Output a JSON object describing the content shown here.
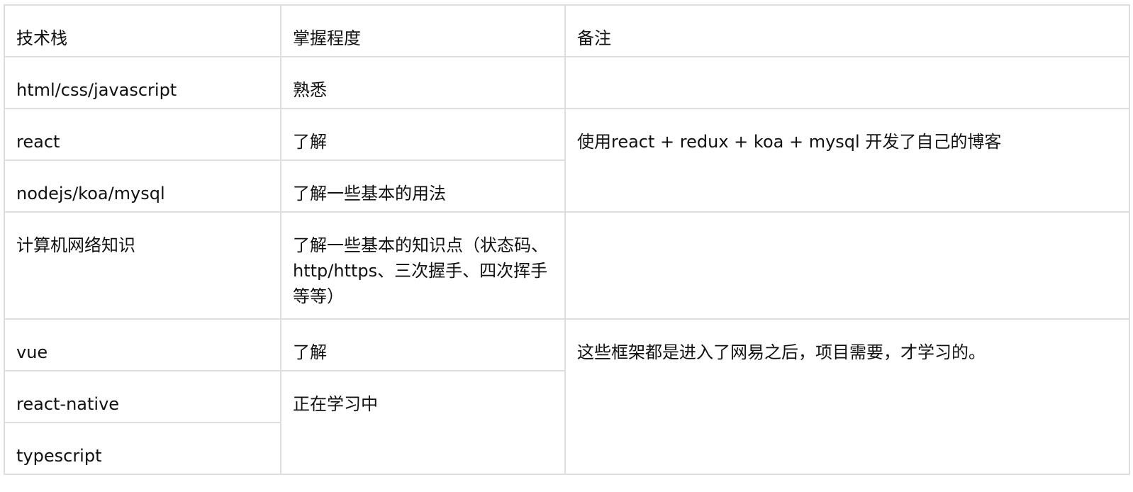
{
  "headers": [
    "技术栈",
    "掌握程度",
    "备注"
  ],
  "rows": [
    {
      "tech": "html/css/javascript",
      "level": "熟悉"
    },
    {
      "tech": "react",
      "level": "了解"
    },
    {
      "tech": "nodejs/koa/mysql",
      "level": "了解一些基本的用法"
    },
    {
      "tech": "计算机网络知识",
      "level": "了解一些基本的知识点（状态码、http/https、三次握手、四次挥手等等）"
    },
    {
      "tech": "vue",
      "level": "了解"
    },
    {
      "tech": "react-native",
      "level": "正在学习中"
    },
    {
      "tech": "typescript"
    }
  ],
  "notes": {
    "react_koa": "使用react + redux + koa + mysql 开发了自己的博客",
    "frameworks": "这些框架都是进入了网易之后，项目需要，才学习的。"
  }
}
